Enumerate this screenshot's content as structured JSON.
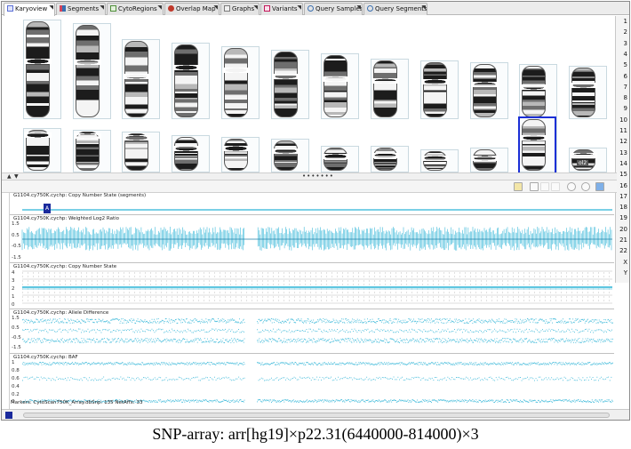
{
  "tabs": [
    {
      "label": "Karyoview",
      "icon": "karyotype-icon",
      "color": "#5b6fd6",
      "active": true
    },
    {
      "label": "Segments",
      "icon": "segments-icon",
      "color": "#d6445a",
      "active": false
    },
    {
      "label": "CytoRegions",
      "icon": "cytoregions-icon",
      "color": "#4f8f3a",
      "active": false
    },
    {
      "label": "Overlap Map",
      "icon": "overlap-map-icon",
      "color": "#c0392b",
      "active": false
    },
    {
      "label": "Graphs",
      "icon": "graphs-icon",
      "color": "#7b7b7b",
      "active": false
    },
    {
      "label": "Variants",
      "icon": "variants-icon",
      "color": "#c2185b",
      "active": false
    },
    {
      "label": "Query Samples",
      "icon": "query-samples-icon",
      "color": "#3a6fb0",
      "active": false
    },
    {
      "label": "Query Segments",
      "icon": "query-segments-icon",
      "color": "#3a6fb0",
      "active": false
    }
  ],
  "ruler": {
    "numbers": [
      "1",
      "2",
      "3",
      "4",
      "5",
      "6",
      "7",
      "8",
      "9",
      "10",
      "11",
      "12",
      "13",
      "14",
      "15",
      "16",
      "17",
      "18",
      "19",
      "20",
      "21",
      "22",
      "X",
      "Y"
    ]
  },
  "karyotype": {
    "row1_count": 12,
    "row2_count": 12,
    "selected_index_row2": 10,
    "last_label": "ol2"
  },
  "tracks": [
    {
      "title": "G1104.cy750K.cychp: Copy Number State (segments)",
      "ticks": []
    },
    {
      "title": "G1104.cy750K.cychp: Weighted Log2 Ratio",
      "ticks": [
        "1.5",
        "0.5",
        "-0.5",
        "-1.5"
      ]
    },
    {
      "title": "G1104.cy750K.cychp: Copy Number State",
      "ticks": [
        "4",
        "3",
        "2",
        "1",
        "0"
      ]
    },
    {
      "title": "G1104.cy750K.cychp: Allele Difference",
      "ticks": [
        "1.5",
        "0.5",
        "-0.5",
        "-1.5"
      ]
    },
    {
      "title": "G1104.cy750K.cychp: BAF",
      "ticks": [
        "1",
        "0.8",
        "0.6",
        "0.4",
        "0.2",
        "0"
      ]
    }
  ],
  "segment_marker_label": "A",
  "status": {
    "text": "Markers: CytoScan750K_Array.dbSnp: 135 NetAffx: 33"
  },
  "caption": "SNP-array: arr[hg19]×p22.31(6440000-814000)×3",
  "colors": {
    "signal": "#2ab3d6",
    "selection": "#1b2fd6",
    "segment_marker": "#1a2a9c"
  }
}
